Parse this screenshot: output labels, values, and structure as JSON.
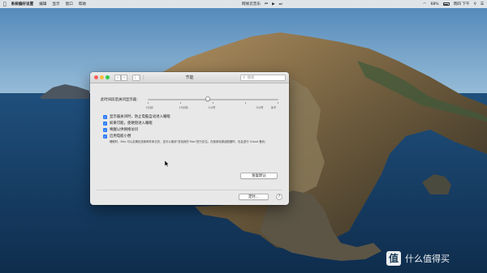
{
  "menubar": {
    "items": [
      "系统偏好设置",
      "编辑",
      "显示",
      "窗口",
      "帮助"
    ],
    "center_items": [
      "网易云音乐",
      "⏮",
      "▶",
      "⏭"
    ],
    "status": [
      "68%",
      "周四 下午"
    ]
  },
  "window": {
    "title": "节能",
    "search_placeholder": "搜索",
    "nav_back": "‹",
    "nav_forward": "›",
    "grid": "⋮⋮⋮"
  },
  "settings": {
    "slider_label": "此时间段后关闭显示器：",
    "slider_value_percent": 46,
    "tick_labels": [
      "1分钟",
      "15分钟",
      "1小时",
      "3小时",
      "永不"
    ],
    "checkboxes": [
      {
        "label": "显示器关闭时，防止电脑自动进入睡眠",
        "checked": true
      },
      {
        "label": "如果可能，使硬盘进入睡眠",
        "checked": true
      },
      {
        "label": "唤醒以供网络访问",
        "checked": true
      },
      {
        "label": "启用电能小憩",
        "checked": true
      }
    ],
    "power_nap_description": "睡眠时，Mac 可以定期检查新邮件和日历，还可以使用\"查找我的 Mac\"进行定位。在使用电源适配器时，也会进行 iCloud 备份。",
    "restore_button": "恢复默认",
    "schedule_button": "定时...",
    "help_button": "?"
  },
  "watermark": {
    "badge": "值",
    "text": "什么值得买"
  }
}
